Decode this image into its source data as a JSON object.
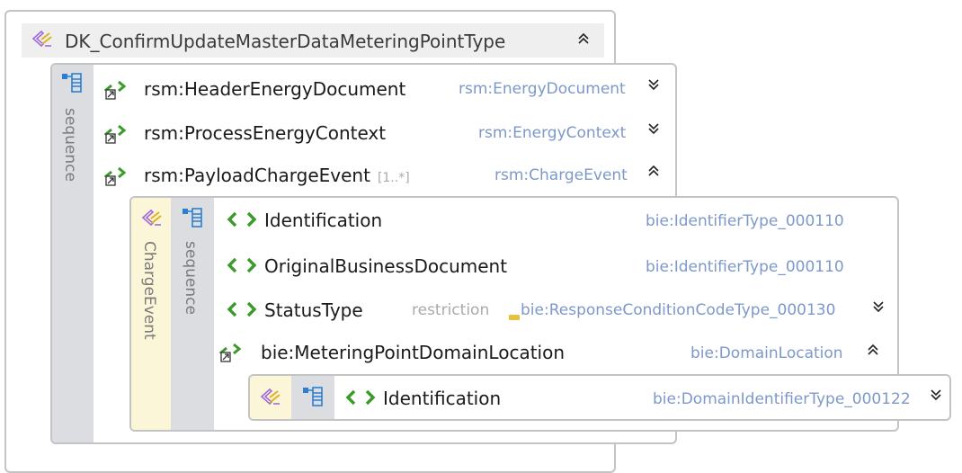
{
  "root": {
    "title": "DK_ConfirmUpdateMasterDataMeteringPointType"
  },
  "sequence1": {
    "label": "sequence",
    "rows": [
      {
        "name": "rsm:HeaderEnergyDocument",
        "type": "rsm:EnergyDocument",
        "multiplicity": ""
      },
      {
        "name": "rsm:ProcessEnergyContext",
        "type": "rsm:EnergyContext",
        "multiplicity": ""
      },
      {
        "name": "rsm:PayloadChargeEvent",
        "type": "rsm:ChargeEvent",
        "multiplicity": "[1..*]"
      }
    ]
  },
  "charge_event": {
    "label": "ChargeEvent",
    "sequence_label": "sequence",
    "rows": [
      {
        "name": "Identification",
        "type": "bie:IdentifierType_000110"
      },
      {
        "name": "OriginalBusinessDocument",
        "type": "bie:IdentifierType_000110"
      },
      {
        "name": "StatusType",
        "restriction": "restriction",
        "type": "bie:ResponseConditionCodeType_000130"
      },
      {
        "name": "bie:MeteringPointDomainLocation",
        "type": "bie:DomainLocation"
      }
    ]
  },
  "domain_location": {
    "rows": [
      {
        "name": "Identification",
        "type": "bie:DomainIdentifierType_000122"
      }
    ]
  },
  "icons": {
    "complex_type": "complex-type-icon",
    "sequence": "sequence-icon",
    "element_ref": "element-ref-icon",
    "element": "element-icon",
    "expand": "chevron-double-down-icon",
    "collapse": "chevron-double-up-icon"
  },
  "colors": {
    "type_text": "#7d98c9",
    "border": "#c4c4c4",
    "sequence_strip": "#dcdde1",
    "complex_strip": "#fcf6d8",
    "element_icon": "#3a9a2a"
  }
}
